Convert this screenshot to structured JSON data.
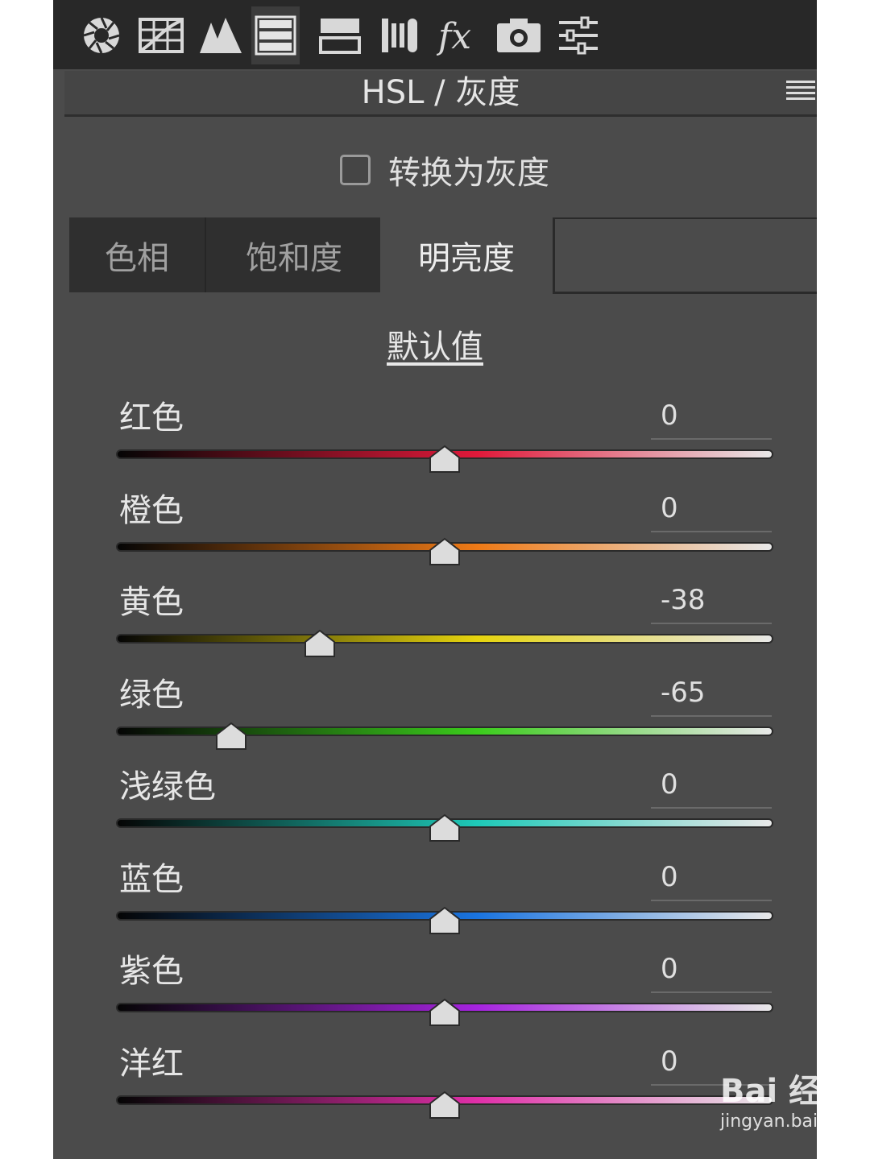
{
  "toolbar": {
    "tools": [
      {
        "icon": "aperture-icon",
        "active": false
      },
      {
        "icon": "grid-tone-curve-icon",
        "active": false
      },
      {
        "icon": "detail-mountains-icon",
        "active": false
      },
      {
        "icon": "hsl-panel-icon",
        "active": true
      },
      {
        "icon": "split-toning-icon",
        "active": false
      },
      {
        "icon": "lens-corrections-icon",
        "active": false
      },
      {
        "icon": "fx-effects-icon",
        "active": false
      },
      {
        "icon": "camera-calibration-icon",
        "active": false
      },
      {
        "icon": "presets-sliders-icon",
        "active": false
      }
    ]
  },
  "header": {
    "title": "HSL / 灰度",
    "menu_icon": "panel-menu-icon"
  },
  "convert": {
    "label": "转换为灰度",
    "checked": false
  },
  "tabs": [
    {
      "label": "色相",
      "active": false
    },
    {
      "label": "饱和度",
      "active": false
    },
    {
      "label": "明亮度",
      "active": true
    }
  ],
  "defaults_link": "默认值",
  "slider_range": [
    -100,
    100
  ],
  "sliders": [
    {
      "label": "红色",
      "value": "0",
      "level": 0,
      "color": "#e0193a"
    },
    {
      "label": "橙色",
      "value": "0",
      "level": 0,
      "color": "#ef7a16"
    },
    {
      "label": "黄色",
      "value": "-38",
      "level": -38,
      "color": "#e6d40e"
    },
    {
      "label": "绿色",
      "value": "-65",
      "level": -65,
      "color": "#3bcc1c"
    },
    {
      "label": "浅绿色",
      "value": "0",
      "level": 0,
      "color": "#1ec9b8"
    },
    {
      "label": "蓝色",
      "value": "0",
      "level": 0,
      "color": "#1a74e0"
    },
    {
      "label": "紫色",
      "value": "0",
      "level": 0,
      "color": "#a623e0"
    },
    {
      "label": "洋红",
      "value": "0",
      "level": 0,
      "color": "#e02fa8"
    }
  ],
  "watermark": {
    "brand": "Bai 经验",
    "url": "jingyan.baidu.com"
  }
}
